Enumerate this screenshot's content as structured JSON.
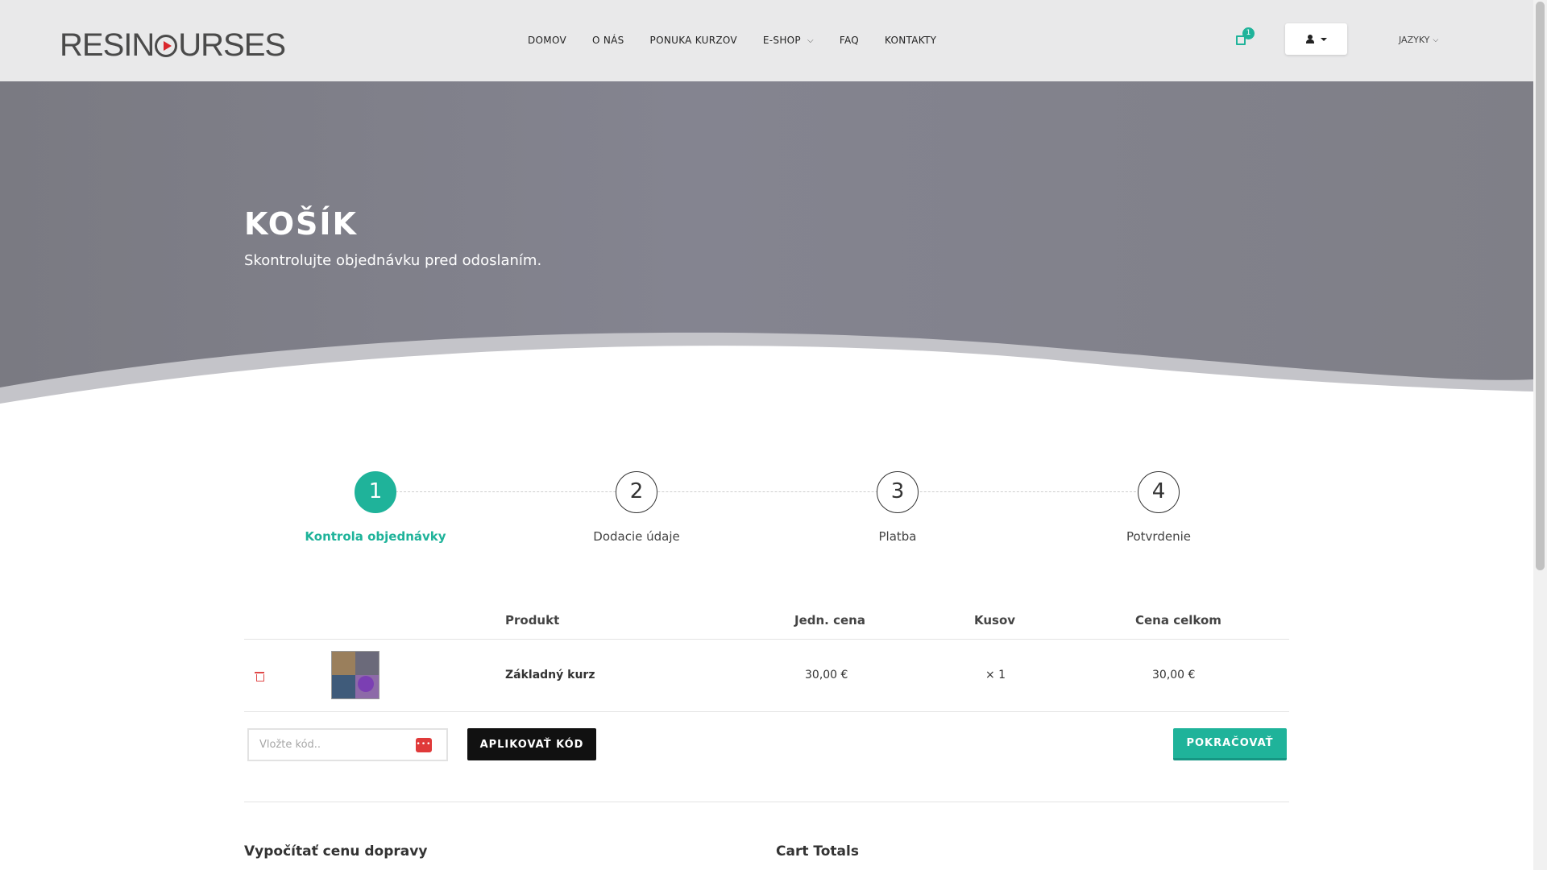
{
  "header": {
    "logo_left": "RESIN",
    "logo_right": "URSES",
    "nav": [
      {
        "label": "DOMOV"
      },
      {
        "label": "O NÁS"
      },
      {
        "label": "PONUKA KURZOV"
      },
      {
        "label": "E-SHOP",
        "has_dropdown": true
      },
      {
        "label": "FAQ"
      },
      {
        "label": "KONTAKTY"
      }
    ],
    "cart_count": "1",
    "languages_label": "JAZYKY"
  },
  "hero": {
    "title": "KOŠÍK",
    "subtitle": "Skontrolujte objednávku pred odoslaním."
  },
  "steps": [
    {
      "number": "1",
      "label": "Kontrola objednávky",
      "active": true
    },
    {
      "number": "2",
      "label": "Dodacie údaje",
      "active": false
    },
    {
      "number": "3",
      "label": "Platba",
      "active": false
    },
    {
      "number": "4",
      "label": "Potvrdenie",
      "active": false
    }
  ],
  "table": {
    "headers": {
      "product": "Produkt",
      "unit_price": "Jedn. cena",
      "quantity": "Kusov",
      "total": "Cena celkom"
    },
    "rows": [
      {
        "product": "Základný kurz",
        "unit_price": "30,00 €",
        "quantity": "× 1",
        "total": "30,00 €"
      }
    ]
  },
  "coupon": {
    "placeholder": "Vložte kód..",
    "apply_label": "APLIKOVAŤ KÓD"
  },
  "continue_label": "POKRAČOVAŤ",
  "sections": {
    "shipping_title": "Vypočítať cenu dopravy",
    "totals_title": "Cart Totals"
  },
  "colors": {
    "accent": "#1fb39a",
    "danger": "#e04848",
    "dark_button": "#111111"
  }
}
